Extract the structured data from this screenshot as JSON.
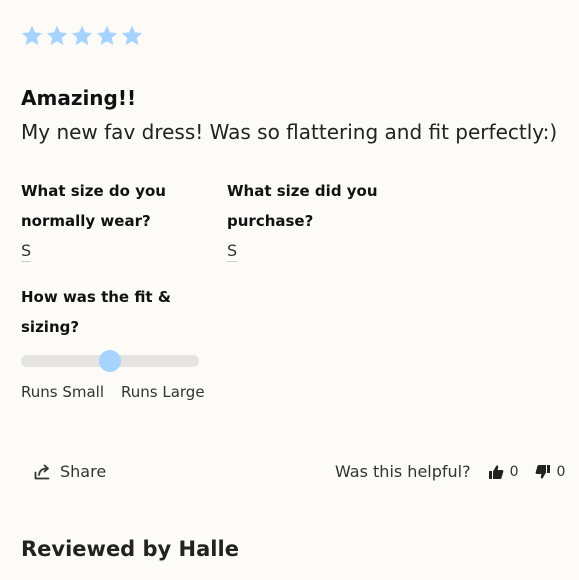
{
  "review": {
    "rating": 5,
    "rating_max": 5,
    "star_color": "#a6d3ff",
    "title": "Amazing!!",
    "body": "My new fav dress! Was so flattering and fit perfectly:)"
  },
  "questions": {
    "normal_size_label": "What size do you normally wear?",
    "normal_size_value": "S",
    "purchased_size_label": "What size did you purchase?",
    "purchased_size_value": "S",
    "fit_label": "How was the fit & sizing?"
  },
  "fit_slider": {
    "value": 0.5,
    "min_label": "Runs Small",
    "max_label": "Runs Large",
    "thumb_color": "#a6d3ff"
  },
  "actions": {
    "share_label": "Share",
    "share_icon": "share-icon",
    "helpful_label": "Was this helpful?",
    "thumbs_up_icon": "thumbs-up-icon",
    "thumbs_up_count": "0",
    "thumbs_down_icon": "thumbs-down-icon",
    "thumbs_down_count": "0"
  },
  "reviewer": {
    "reviewed_by": "Reviewed by Halle"
  }
}
